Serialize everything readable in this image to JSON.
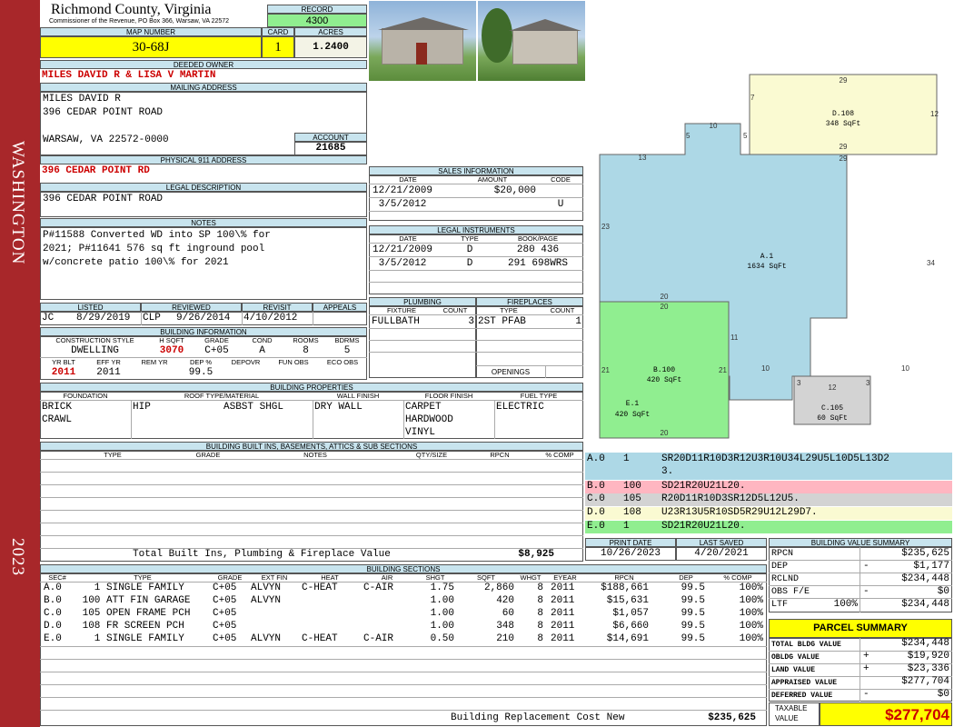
{
  "sidebar": {
    "county_label": "WASHINGTON",
    "year": "2023"
  },
  "header": {
    "county": "Richmond County, Virginia",
    "commissioner": "Commissioner of the Revenue, PO Box 366, Warsaw, VA 22572"
  },
  "record": {
    "label": "RECORD",
    "value": "4300"
  },
  "map_number": {
    "label": "MAP NUMBER",
    "value": "30-68J"
  },
  "card": {
    "label": "CARD",
    "value": "1"
  },
  "acres": {
    "label": "ACRES",
    "value": "1.2400"
  },
  "owner": {
    "label": "DEEDED OWNER",
    "value": "MILES DAVID R & LISA V MARTIN"
  },
  "mailing": {
    "label": "MAILING ADDRESS",
    "line1": "MILES DAVID R",
    "line2": "396 CEDAR POINT ROAD",
    "line3": "WARSAW, VA 22572-0000"
  },
  "account": {
    "label": "ACCOUNT",
    "value": "21685"
  },
  "physical": {
    "label": "PHYSICAL 911 ADDRESS",
    "value": "396 CEDAR POINT RD"
  },
  "legal": {
    "label": "LEGAL DESCRIPTION",
    "value": "396 CEDAR POINT ROAD"
  },
  "notes": {
    "label": "NOTES",
    "line1": "P#11588 Converted WD into SP 100\\% for",
    "line2": "2021; P#11641 576 sq ft inground pool",
    "line3": "w/concrete patio 100\\% for 2021"
  },
  "sales": {
    "title": "SALES INFORMATION",
    "headers": {
      "date": "DATE",
      "amount": "AMOUNT",
      "code": "CODE"
    },
    "rows": [
      {
        "date": "12/21/2009",
        "amount": "$20,000",
        "code": ""
      },
      {
        "date": " 3/5/2012",
        "amount": "",
        "code": "U"
      }
    ]
  },
  "legal_instruments": {
    "title": "LEGAL INSTRUMENTS",
    "headers": {
      "date": "DATE",
      "type": "TYPE",
      "bookpage": "BOOK/PAGE"
    },
    "rows": [
      {
        "date": "12/21/2009",
        "type": "D",
        "bookpage": "280 436"
      },
      {
        "date": " 3/5/2012",
        "type": "D",
        "bookpage": "291 698WRS"
      }
    ]
  },
  "review": {
    "listed_label": "LISTED",
    "reviewed_label": "REVIEWED",
    "revisit_label": "REVISIT",
    "appeals_label": "APPEALS",
    "listed_by": "JC",
    "listed_date": "8/29/2019",
    "reviewed_by": "CLP",
    "reviewed_date": "9/26/2014",
    "revisit": "4/10/2012",
    "appeals": ""
  },
  "plumbing": {
    "title": "PLUMBING",
    "fixture_label": "FIXTURE",
    "count_label": "COUNT",
    "rows": [
      {
        "fixture": "FULLBATH",
        "count": "3"
      }
    ]
  },
  "fireplaces": {
    "title": "FIREPLACES",
    "type_label": "TYPE",
    "count_label": "COUNT",
    "rows": [
      {
        "type": "2ST PFAB",
        "count": "1"
      }
    ],
    "openings_label": "OPENINGS"
  },
  "building_info": {
    "title": "BUILDING INFORMATION",
    "labels": {
      "style": "CONSTRUCTION STYLE",
      "hsqft": "H SQFT",
      "grade": "GRADE",
      "cond": "COND",
      "rooms": "ROOMS",
      "bdrms": "BDRMS",
      "yrblt": "YR BLT",
      "effyr": "EFF YR",
      "remyr": "REM YR",
      "dep": "DEP %",
      "depovr": "DEPOVR",
      "funobs": "FUN OBS",
      "ecoobs": "ECO OBS"
    },
    "style": "DWELLING",
    "hsqft": "3070",
    "grade": "C+05",
    "cond": "A",
    "rooms": "8",
    "bdrms": "5",
    "yrblt": "2011",
    "effyr": "2011",
    "remyr": "",
    "dep": "99.5",
    "depovr": "",
    "funobs": "",
    "ecoobs": ""
  },
  "properties": {
    "title": "BUILDING PROPERTIES",
    "labels": {
      "foundation": "FOUNDATION",
      "roof": "ROOF TYPE/MATERIAL",
      "wall": "WALL FINISH",
      "floor": "FLOOR FINISH",
      "fuel": "FUEL TYPE"
    },
    "foundation": [
      "BRICK",
      "CRAWL"
    ],
    "roof_type": "HIP",
    "roof_material": "ASBST SHGL",
    "wall": "DRY WALL",
    "floor": [
      "CARPET",
      "HARDWOOD",
      "VINYL"
    ],
    "fuel": "ELECTRIC"
  },
  "builtins": {
    "title": "BUILDING BUILT INS, BASEMENTS, ATTICS & SUB SECTIONS",
    "headers": {
      "type": "TYPE",
      "grade": "GRADE",
      "notes": "NOTES",
      "qty": "QTY/SIZE",
      "rpcn": "RPCN",
      "comp": "% COMP"
    },
    "total_label": "Total Built Ins, Plumbing & Fireplace Value",
    "total_value": "$8,925"
  },
  "sketch_codes": [
    {
      "sec": "A.0",
      "code": "1",
      "path": "SR20D11R10D3R12U3R10U34L29U5L10D5L13D2",
      "path2": "3."
    },
    {
      "sec": "B.0",
      "code": "100",
      "path": "SD21R20U21L20."
    },
    {
      "sec": "C.0",
      "code": "105",
      "path": "R20D11R10D3SR12D5L12U5."
    },
    {
      "sec": "D.0",
      "code": "108",
      "path": "U23R13U5R10SD5R29U12L29D7."
    },
    {
      "sec": "E.0",
      "code": "1",
      "path": "SD21R20U21L20."
    }
  ],
  "sketch": {
    "a_label": "A.1",
    "a_area": "1634 SqFt",
    "b_label": "B.100",
    "b_area": "420 SqFt",
    "c_label": "C.105",
    "c_area": "60 SqFt",
    "d_label": "D.108",
    "d_area": "348 SqFt",
    "e_label": "E.1",
    "e_area": "420 SqFt",
    "dims": [
      "29",
      "12",
      "7",
      "5",
      "5",
      "10",
      "13",
      "29",
      "29",
      "23",
      "34",
      "20",
      "20",
      "11",
      "21",
      "21",
      "10",
      "10",
      "3",
      "3",
      "12",
      "20"
    ]
  },
  "print": {
    "print_label": "PRINT DATE",
    "saved_label": "LAST SAVED",
    "print_date": "10/26/2023",
    "last_saved": "4/20/2021"
  },
  "value_summary": {
    "title": "BUILDING VALUE SUMMARY",
    "rows": [
      {
        "label": "RPCN",
        "sign": "",
        "value": "$235,625"
      },
      {
        "label": "DEP",
        "sign": "-",
        "value": "$1,177"
      },
      {
        "label": "RCLND",
        "sign": "",
        "value": "$234,448"
      },
      {
        "label": "OBS F/E",
        "sign": "-",
        "value": "$0"
      },
      {
        "label": "LTF",
        "sign": "100%",
        "value": "$234,448"
      }
    ]
  },
  "parcel_summary": {
    "title": "PARCEL SUMMARY",
    "rows": [
      {
        "label": "TOTAL BLDG VALUE",
        "sign": "",
        "value": "$234,448"
      },
      {
        "label": "OBLDG VALUE",
        "sign": "+",
        "value": "$19,920"
      },
      {
        "label": "LAND VALUE",
        "sign": "+",
        "value": "$23,336"
      },
      {
        "label": "APPRAISED VALUE",
        "sign": "",
        "value": "$277,704"
      },
      {
        "label": "DEFERRED VALUE",
        "sign": "-",
        "value": "$0"
      }
    ],
    "taxable_label1": "TAXABLE",
    "taxable_label2": "VALUE",
    "taxable_value": "$277,704"
  },
  "sections": {
    "title": "BUILDING SECTIONS",
    "headers": {
      "sec": "SEC#",
      "type": "TYPE",
      "grade": "GRADE",
      "ext": "EXT FIN",
      "heat": "HEAT",
      "air": "AIR",
      "shgt": "SHGT",
      "sqft": "SQFT",
      "whgt": "WHGT",
      "eyear": "EYEAR",
      "rpcn": "RPCN",
      "dep": "DEP",
      "comp": "% COMP"
    },
    "rows": [
      {
        "sec": "A.0",
        "type": "   1 SINGLE FAMILY",
        "grade": "C+05",
        "ext": "ALVYN",
        "heat": "C-HEAT",
        "air": "C-AIR",
        "shgt": "1.75",
        "sqft": "2,860",
        "whgt": "8",
        "eyear": "2011",
        "rpcn": "$188,661",
        "dep": "99.5",
        "comp": "100%"
      },
      {
        "sec": "B.0",
        "type": " 100 ATT FIN GARAGE",
        "grade": "C+05",
        "ext": "ALVYN",
        "heat": "",
        "air": "",
        "shgt": "1.00",
        "sqft": "420",
        "whgt": "8",
        "eyear": "2011",
        "rpcn": "$15,631",
        "dep": "99.5",
        "comp": "100%"
      },
      {
        "sec": "C.0",
        "type": " 105 OPEN FRAME PCH",
        "grade": "C+05",
        "ext": "",
        "heat": "",
        "air": "",
        "shgt": "1.00",
        "sqft": "60",
        "whgt": "8",
        "eyear": "2011",
        "rpcn": "$1,057",
        "dep": "99.5",
        "comp": "100%"
      },
      {
        "sec": "D.0",
        "type": " 108 FR SCREEN PCH",
        "grade": "C+05",
        "ext": "",
        "heat": "",
        "air": "",
        "shgt": "1.00",
        "sqft": "348",
        "whgt": "8",
        "eyear": "2011",
        "rpcn": "$6,660",
        "dep": "99.5",
        "comp": "100%"
      },
      {
        "sec": "E.0",
        "type": "   1 SINGLE FAMILY",
        "grade": "C+05",
        "ext": "ALVYN",
        "heat": "C-HEAT",
        "air": "C-AIR",
        "shgt": "0.50",
        "sqft": "210",
        "whgt": "8",
        "eyear": "2011",
        "rpcn": "$14,691",
        "dep": "99.5",
        "comp": "100%"
      }
    ],
    "replacement_label": "Building Replacement Cost New",
    "replacement_value": "$235,625"
  }
}
